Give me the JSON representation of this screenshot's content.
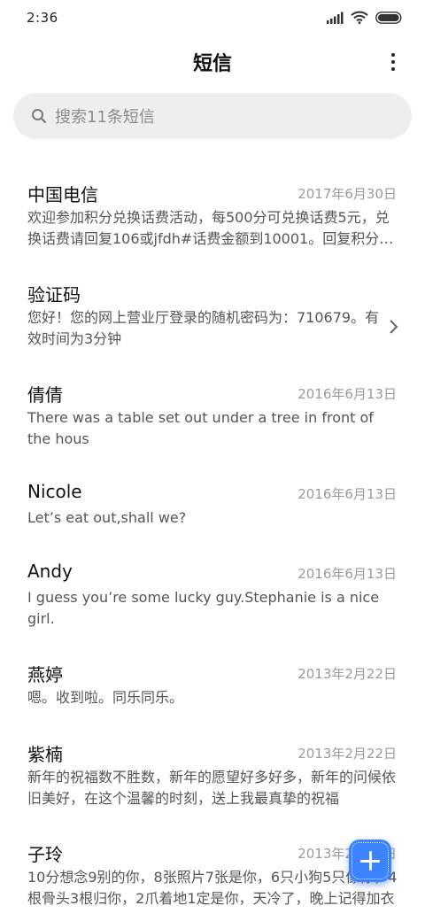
{
  "status_bar": {
    "time": "2:36",
    "icons": [
      "signal-icon",
      "wifi-icon",
      "battery-icon"
    ]
  },
  "header": {
    "title": "短信",
    "menu_icon": "more-vertical-icon"
  },
  "search": {
    "placeholder": "搜索11条短信",
    "icon": "search-icon"
  },
  "conversations": [
    {
      "name": "中国电信",
      "date": "2017年6月30日",
      "preview": "欢迎参加积分兑换话费活动，每500分可兑换话费5元，兑换话费请回复106或jfdh#话费金额到10001。回复积分查询可以查询当前积分"
    },
    {
      "name": "验证码",
      "date": "",
      "preview": "您好！您的网上营业厅登录的随机密码为：710679。有效时间为3分钟",
      "has_chevron": true
    },
    {
      "name": "倩倩",
      "date": "2016年6月13日",
      "preview": "There was a table set out under a tree in front of the hous"
    },
    {
      "name": "Nicole",
      "date": "2016年6月13日",
      "preview": "Let’s eat out,shall we?"
    },
    {
      "name": "Andy",
      "date": "2016年6月13日",
      "preview": "I guess you’re some lucky guy.Stephanie is a nice girl."
    },
    {
      "name": "燕婷",
      "date": "2013年2月22日",
      "preview": "嗯。收到啦。同乐同乐。"
    },
    {
      "name": "紫楠",
      "date": "2013年2月22日",
      "preview": "新年的祝福数不胜数，新年的愿望好多好多，新年的问候依旧美好，在这个温馨的时刻，送上我最真挚的祝福"
    },
    {
      "name": "子玲",
      "date": "2013年2月22日",
      "preview": "10分想念9别的你，8张照片7张是你，6只小狗5只像你，4根骨头3根归你，2爪着地1定是你，天冷了，晚上记得加衣"
    }
  ],
  "fab": {
    "icon": "plus-icon"
  },
  "colors": {
    "accent": "#3c84ff",
    "search_bg": "#eeeeee",
    "date_text": "#9a9a9a",
    "preview_text": "#555555"
  }
}
